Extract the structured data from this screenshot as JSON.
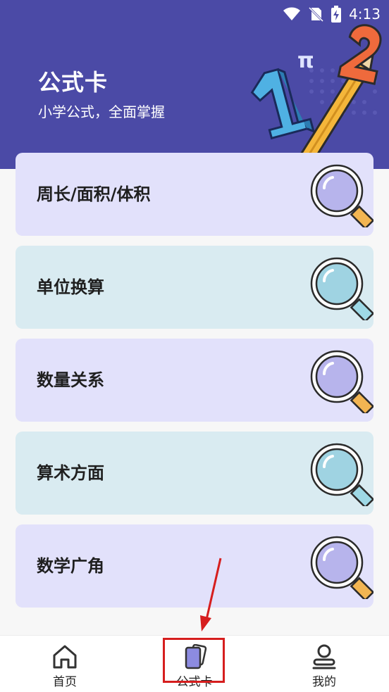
{
  "status_bar": {
    "time": "4:13"
  },
  "header": {
    "title": "公式卡",
    "subtitle": "小学公式，全面掌握"
  },
  "cards": [
    {
      "label": "周长/面积/体积",
      "bg": "#e2e1fb",
      "accent": "#b7b4ec"
    },
    {
      "label": "单位换算",
      "bg": "#d9ebf1",
      "accent": "#9fd3e2"
    },
    {
      "label": "数量关系",
      "bg": "#e2e1fb",
      "accent": "#b7b4ec"
    },
    {
      "label": "算术方面",
      "bg": "#d9ebf1",
      "accent": "#9fd3e2"
    },
    {
      "label": "数学广角",
      "bg": "#e2e1fb",
      "accent": "#b7b4ec"
    }
  ],
  "bottom_nav": {
    "items": [
      {
        "label": "首页",
        "icon": "home-icon"
      },
      {
        "label": "公式卡",
        "icon": "cards-icon"
      },
      {
        "label": "我的",
        "icon": "user-icon"
      }
    ]
  },
  "colors": {
    "header_bg": "#4b4aa6",
    "annotation_red": "#d61e1e"
  }
}
